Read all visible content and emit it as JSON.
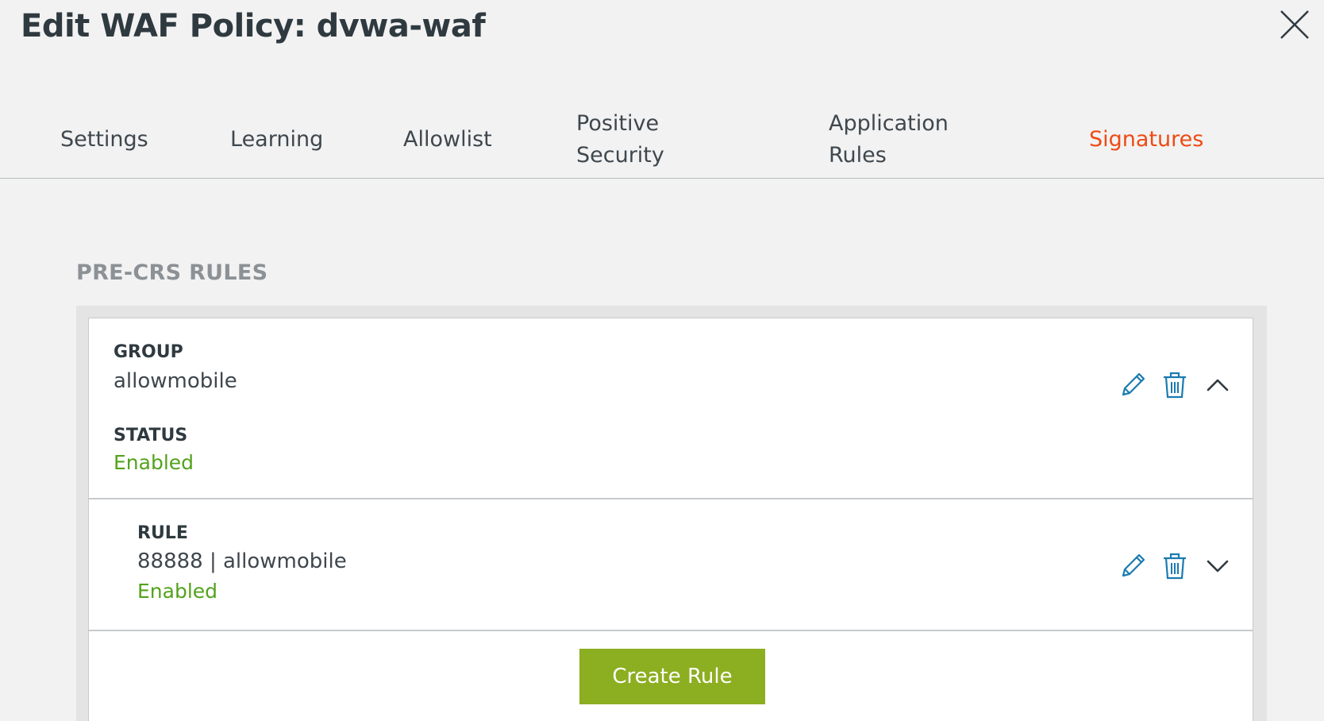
{
  "modal": {
    "title": "Edit WAF Policy: dvwa-waf"
  },
  "tabs": [
    {
      "label_line1": "Settings",
      "label_line2": ""
    },
    {
      "label_line1": "Learning",
      "label_line2": ""
    },
    {
      "label_line1": "Allowlist",
      "label_line2": ""
    },
    {
      "label_line1": "Positive",
      "label_line2": "Security"
    },
    {
      "label_line1": "Application",
      "label_line2": "Rules"
    },
    {
      "label_line1": "Signatures",
      "label_line2": "",
      "active": true
    }
  ],
  "section": {
    "title": "PRE-CRS RULES"
  },
  "group": {
    "group_label": "GROUP",
    "group_name": "allowmobile",
    "status_label": "STATUS",
    "status_value": "Enabled",
    "icons": [
      "pencil-icon",
      "trash-icon",
      "chevron-up-icon"
    ]
  },
  "rule": {
    "rule_label": "RULE",
    "rule_value": "88888 | allowmobile",
    "status_value": "Enabled",
    "icons": [
      "pencil-icon",
      "trash-icon",
      "chevron-down-icon"
    ]
  },
  "footer": {
    "create_rule_label": "Create Rule"
  },
  "colors": {
    "accent_active_tab": "#ee4b14",
    "status_enabled": "#54a21d",
    "primary_button": "#8cae21",
    "icon_blue": "#1a7bb0",
    "background": "#f2f2f2"
  }
}
